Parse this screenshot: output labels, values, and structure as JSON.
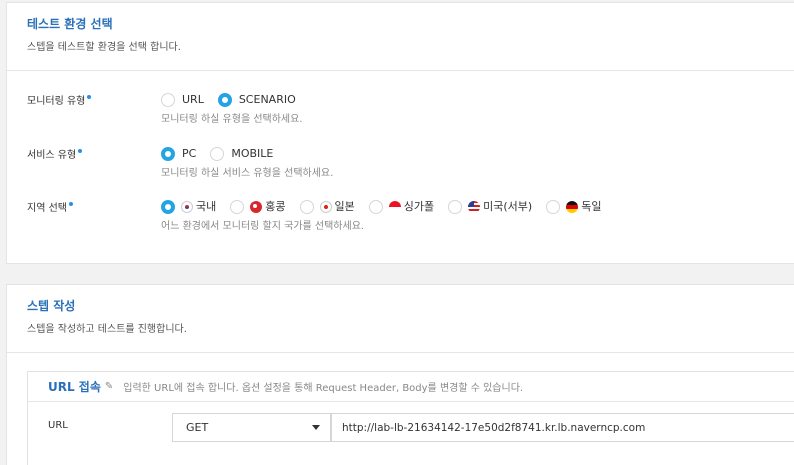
{
  "env_section": {
    "title": "테스트 환경 선택",
    "subtitle": "스텝을 테스트할 환경을 선택 합니다.",
    "monitoring_type": {
      "label": "모니터링 유형",
      "options": [
        "URL",
        "SCENARIO"
      ],
      "selected": "SCENARIO",
      "hint": "모니터링 하실 유형을 선택하세요."
    },
    "service_type": {
      "label": "서비스 유형",
      "options": [
        "PC",
        "MOBILE"
      ],
      "selected": "PC",
      "hint": "모니터링 하실 서비스 유형을 선택하세요."
    },
    "region": {
      "label": "지역 선택",
      "options": [
        {
          "label": "국내",
          "flag": "flag-korea-icon"
        },
        {
          "label": "홍콩",
          "flag": "flag-hongkong-icon"
        },
        {
          "label": "일본",
          "flag": "flag-japan-icon"
        },
        {
          "label": "싱가폴",
          "flag": "flag-singapore-icon"
        },
        {
          "label": "미국(서부)",
          "flag": "flag-usa-icon"
        },
        {
          "label": "독일",
          "flag": "flag-germany-icon"
        }
      ],
      "selected": "국내",
      "hint": "어느 환경에서 모니터링 할지 국가를 선택하세요."
    }
  },
  "step_section": {
    "title": "스텝 작성",
    "subtitle": "스텝을 작성하고 테스트를 진행합니다.",
    "url_access": {
      "title": "URL 접속",
      "edit_icon": "pencil-icon",
      "description": "입력한 URL에 접속 합니다. 옵션 설정을 통해 Request Header, Body를 변경할 수 있습니다.",
      "url_label": "URL",
      "method": "GET",
      "url_value": "http://lab-lb-21634142-17e50d2f8741.kr.lb.naverncp.com"
    }
  },
  "colors": {
    "accent_blue": "#2a6fb9",
    "radio_active": "#25a4e3",
    "required_dot": "#2b8ee6"
  }
}
